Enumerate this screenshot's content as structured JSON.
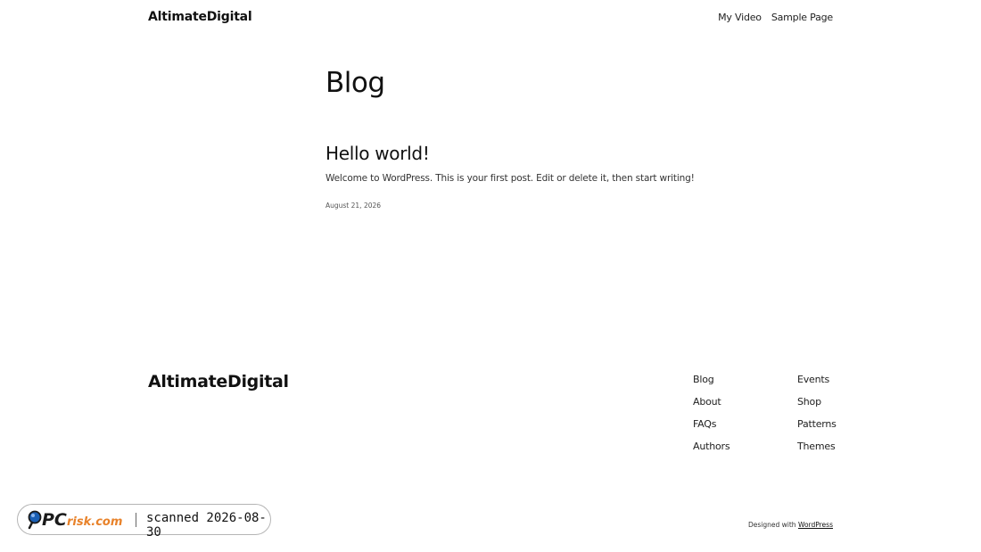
{
  "header": {
    "site_title": "AltimateDigital",
    "nav": [
      "My Video",
      "Sample Page"
    ]
  },
  "main": {
    "heading": "Blog",
    "posts": [
      {
        "title": "Hello world!",
        "excerpt": "Welcome to WordPress. This is your first post. Edit or delete it, then start writing!",
        "date": "August 21, 2026"
      }
    ]
  },
  "footer": {
    "site_title": "AltimateDigital",
    "links_col1": [
      "Blog",
      "About",
      "FAQs",
      "Authors"
    ],
    "links_col2": [
      "Events",
      "Shop",
      "Patterns",
      "Themes"
    ],
    "credit_prefix": "Designed with",
    "credit_link": "WordPress"
  },
  "watermark": {
    "logo_text": "PCrisk.com",
    "scan_text": "scanned 2026-08-30",
    "colors": {
      "pc": "#1a1a1a",
      "risk": "#e8822a",
      "lens": "#1a5fb4"
    }
  }
}
